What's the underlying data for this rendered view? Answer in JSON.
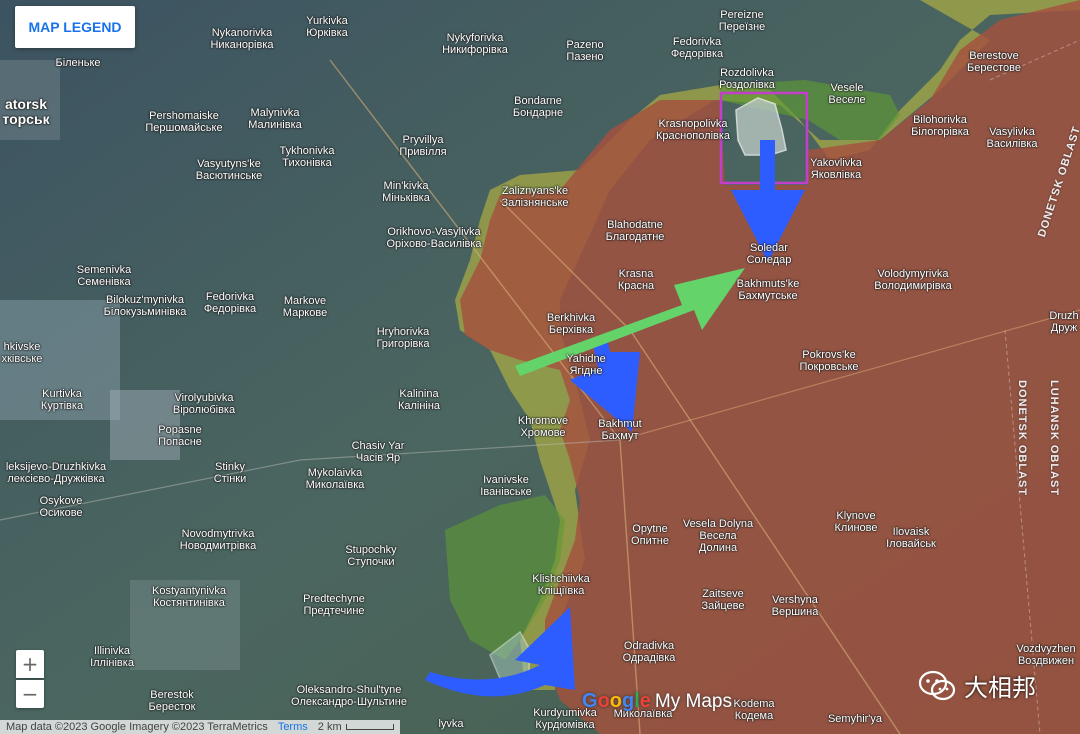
{
  "legend_button": "MAP LEGEND",
  "zoom": {
    "in": "+",
    "out": "−"
  },
  "footer": {
    "attribution": "Map data ©2023 Google Imagery ©2023 TerraMetrics",
    "terms": "Terms",
    "scale": "2 km"
  },
  "logo": {
    "google": "Google",
    "mymaps": "My Maps"
  },
  "watermark": "大相邦",
  "colors": {
    "occupied": "#a5503e",
    "contested": "#c8c23a",
    "liberated": "#5e9a34",
    "arrow_blue": "#2e5dff",
    "arrow_green": "#64d46a",
    "highlight": "#c23fcc"
  },
  "oblasts": {
    "donetsk_top": "DONETSK OBLAST",
    "luhansk": "LUHANSK OBLAST",
    "donetsk_right": "DONETSK OBLAST"
  },
  "places": {
    "kramatorsk": [
      "atorsk",
      "торськ"
    ],
    "bilenke": [
      "",
      "Біленьке"
    ],
    "nykanorivka": [
      "Nykanorivka",
      "Никанорівка"
    ],
    "yurkivka": [
      "Yurkivka",
      "Юрківка"
    ],
    "nykyforivka": [
      "Nykyforivka",
      "Никифорівка"
    ],
    "pazeno": [
      "Pazeno",
      "Пазено"
    ],
    "pereizne": [
      "Pereizne",
      "Переїзне"
    ],
    "fedorivka_n": [
      "Fedorivka",
      "Федорівка"
    ],
    "rozdolivka": [
      "Rozdolivka",
      "Роздолівка"
    ],
    "vesele": [
      "Vesele",
      "Веселе"
    ],
    "berestove": [
      "Berestove",
      "Берестове"
    ],
    "bilohorivka": [
      "Bilohorivka",
      "Білогорівка"
    ],
    "vasylivka": [
      "Vasylivka",
      "Василівка"
    ],
    "pershomaiske": [
      "Pershomaiske",
      "Першомайське"
    ],
    "malynivka": [
      "Malynivka",
      "Малинівка"
    ],
    "bondarne": [
      "Bondarne",
      "Бондарне"
    ],
    "krasnopolivka": [
      "Krasnopolivka",
      "Краснополівка"
    ],
    "yakovlivka": [
      "Yakovlivka",
      "Яковлівка"
    ],
    "prylyllia": [
      "Pryvillya",
      "Привілля"
    ],
    "tykhonivka": [
      "Tykhonivka",
      "Тихонівка"
    ],
    "vasiutynske": [
      "Vasyutyns'ke",
      "Васютинське"
    ],
    "minkivka": [
      "Min'kivka",
      "Міньківка"
    ],
    "zaliznianske": [
      "Zaliznyans'ke",
      "Залізнянське"
    ],
    "blahodatne": [
      "Blahodatne",
      "Благодатне"
    ],
    "soledar": [
      "Soledar",
      "Соледар"
    ],
    "orikhovo": [
      "Orikhovo-Vasylivka",
      "Оріхово-Василівка"
    ],
    "krasna_hora": [
      "Krasna",
      "Красна"
    ],
    "bakhmutske": [
      "Bakhmuts'ke",
      "Бахмутське"
    ],
    "volodymyrivka": [
      "Volodymyrivka",
      "Володимирівка"
    ],
    "semenivka": [
      "Semenivka",
      "Семенівка"
    ],
    "bilokuzmynivka": [
      "Bilokuz'mynivka",
      "Білокузьминівка"
    ],
    "fedorivka_w": [
      "Fedorivka",
      "Федорівка"
    ],
    "markove": [
      "Markove",
      "Маркове"
    ],
    "berkhivka": [
      "Berkhivka",
      "Берхівка"
    ],
    "yahidne": [
      "Yahidne",
      "Ягідне"
    ],
    "hryhorivka": [
      "Hryhorivka",
      "Григорівка"
    ],
    "khrykivske": [
      "hkivske",
      "хківське"
    ],
    "pokrovske": [
      "Pokrovs'ke",
      "Покровське"
    ],
    "druzhba": [
      "Druzh",
      "Друж"
    ],
    "kalinina": [
      "Kalinina",
      "Калініна"
    ],
    "kurtivka": [
      "Kurtivka",
      "Куртівка"
    ],
    "virolyubivka": [
      "Virolyubivka",
      "Віролюбівка"
    ],
    "popasne": [
      "Popasne",
      "Попасне"
    ],
    "khromove": [
      "Khromove",
      "Хромове"
    ],
    "bakhmut": [
      "Bakhmut",
      "Бахмут"
    ],
    "chasiv_yar": [
      "Chasiv Yar",
      "Часів Яр"
    ],
    "oleksiievo": [
      "leksijevo-Druzhkivka",
      "лексієво-Дружківка"
    ],
    "stinky": [
      "Stinky",
      "Стінки"
    ],
    "mykolaivka": [
      "Mykolaivka",
      "Миколаївка"
    ],
    "ivanivske": [
      "Ivanivske",
      "Іванівське"
    ],
    "osykove": [
      "Osykove",
      "Осикове"
    ],
    "novodmytrivka": [
      "Novodmytrivka",
      "Новодмитрівка"
    ],
    "opytne": [
      "Opytne",
      "Опитне"
    ],
    "vesela_dolyna": [
      "Vesela Dolyna",
      "Весела",
      "Долина"
    ],
    "klynove": [
      "Klynove",
      "Клинове"
    ],
    "ilovaisk": [
      "Ilovaisk",
      "Іловайськ"
    ],
    "stupochky": [
      "Stupochky",
      "Ступочки"
    ],
    "kostiantynivka": [
      "Kostyantynivka",
      "Костянтинівка"
    ],
    "klishchiivka": [
      "Klishchiivka",
      "Кліщіївка"
    ],
    "predtechyne": [
      "Predtechyne",
      "Предтечине"
    ],
    "zaitseve": [
      "Zaitseve",
      "Зайцеве"
    ],
    "vershyna": [
      "Vershyna",
      "Вершина"
    ],
    "illinivka": [
      "Illinivka",
      "Іллінівка"
    ],
    "odradivka": [
      "Odradivka",
      "Одрадівка"
    ],
    "vozdvyzhenka": [
      "Vozdvyzhen",
      "Воздвижен"
    ],
    "oleksandro": [
      "Oleksandro-Shul'tyne",
      "Олександро-Шультине"
    ],
    "berestok": [
      "Berestok",
      "Бересток"
    ],
    "kurdiumivka": [
      "Kurdyumivka",
      "Курдюмівка"
    ],
    "mykolaivka2": [
      "",
      "Миколаївка"
    ],
    "kodema": [
      "Kodema",
      "Кодема"
    ],
    "semyhiria": [
      "Semyhir'ya",
      ""
    ],
    "ivka": [
      "lyvka",
      ""
    ]
  }
}
